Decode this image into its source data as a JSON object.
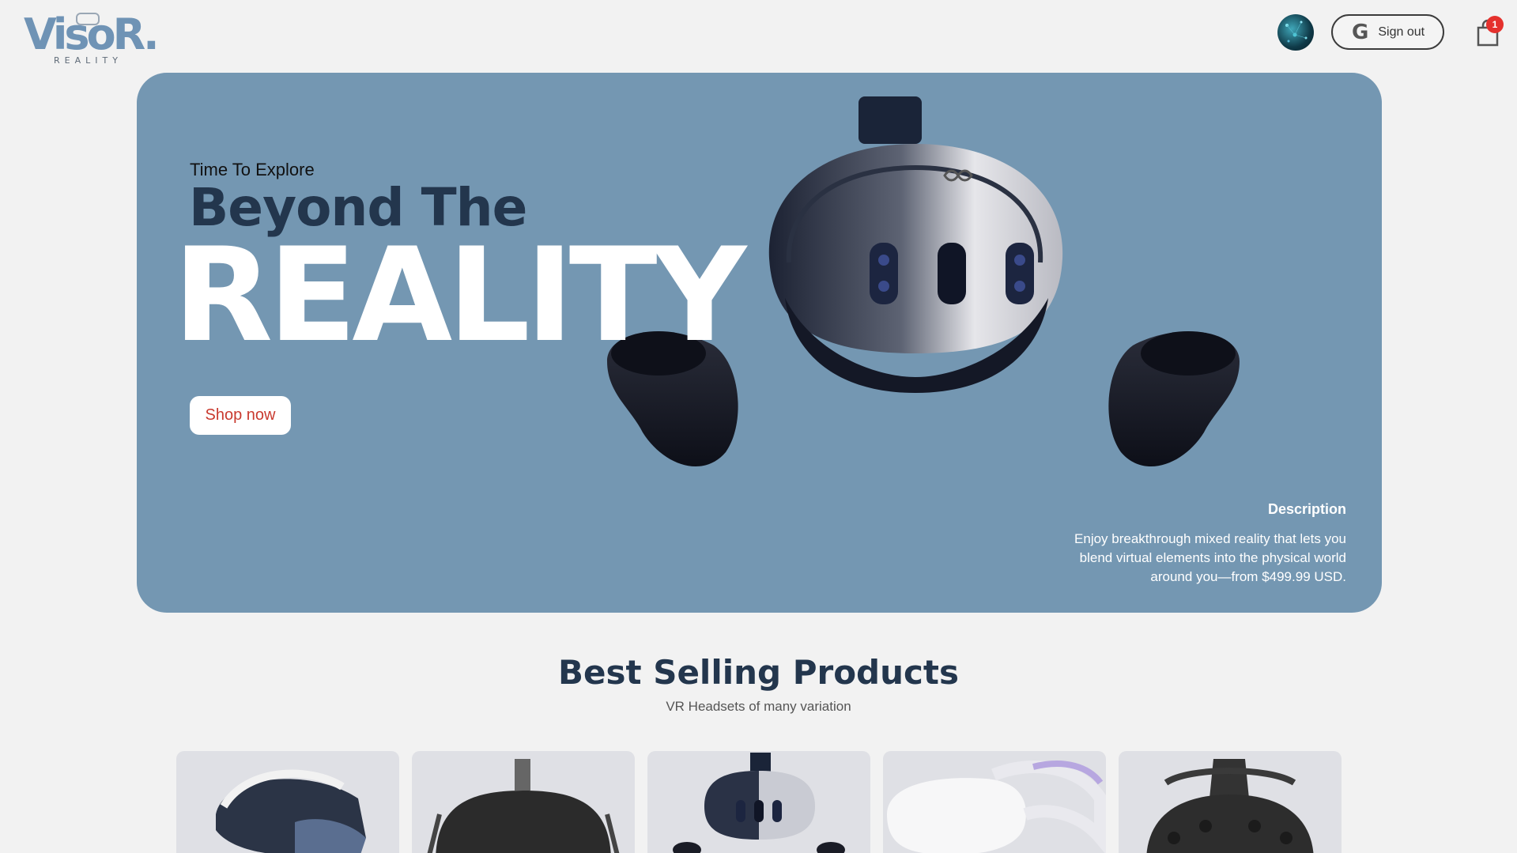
{
  "header": {
    "logo_text": "VisoR.",
    "logo_subtext": "REALITY",
    "signout_label": "Sign out",
    "google_glyph": "G",
    "cart_count": "1"
  },
  "hero": {
    "eyebrow": "Time To Explore",
    "headline": "Beyond The",
    "headline_big": "REALITY",
    "cta_label": "Shop now",
    "description_title": "Description",
    "description": "Enjoy breakthrough mixed reality that lets you blend virtual elements into the physical world around you—from $499.99 USD.",
    "background_color": "#7497b2"
  },
  "best_selling": {
    "title": "Best Selling Products",
    "subtitle": "VR Headsets of many variation",
    "products": [
      {
        "name": "gear-vr-headset"
      },
      {
        "name": "oculus-rift-headset"
      },
      {
        "name": "meta-quest-3-headset"
      },
      {
        "name": "quest-2-headset"
      },
      {
        "name": "htc-vive-headset"
      }
    ]
  },
  "icons": {
    "cart": "shopping-bag-icon",
    "google": "google-icon"
  }
}
